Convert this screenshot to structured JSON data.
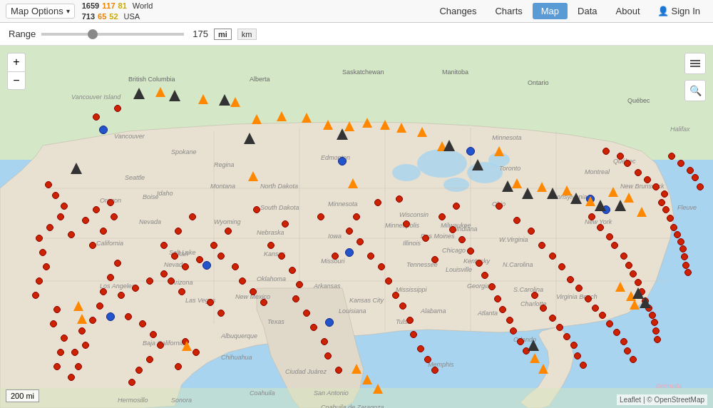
{
  "topbar": {
    "map_options_label": "Map Options",
    "stats": {
      "world_count": "1659",
      "world_orange": "117",
      "world_yellow": "81",
      "world_label": "World",
      "usa_count": "713",
      "usa_orange": "65",
      "usa_yellow": "52",
      "usa_label": "USA"
    },
    "nav": {
      "changes": "Changes",
      "charts": "Charts",
      "map": "Map",
      "data": "Data",
      "about": "About",
      "sign_in": "Sign In"
    }
  },
  "rangebar": {
    "label": "Range",
    "value": "175",
    "unit_mi": "mi",
    "unit_km": "km",
    "active_unit": "mi",
    "slider_max": "500",
    "slider_value": "175"
  },
  "map": {
    "zoom_in": "+",
    "zoom_out": "−",
    "attribution": "Leaflet | © OpenStreetMap",
    "scale_label": "200 mi"
  }
}
